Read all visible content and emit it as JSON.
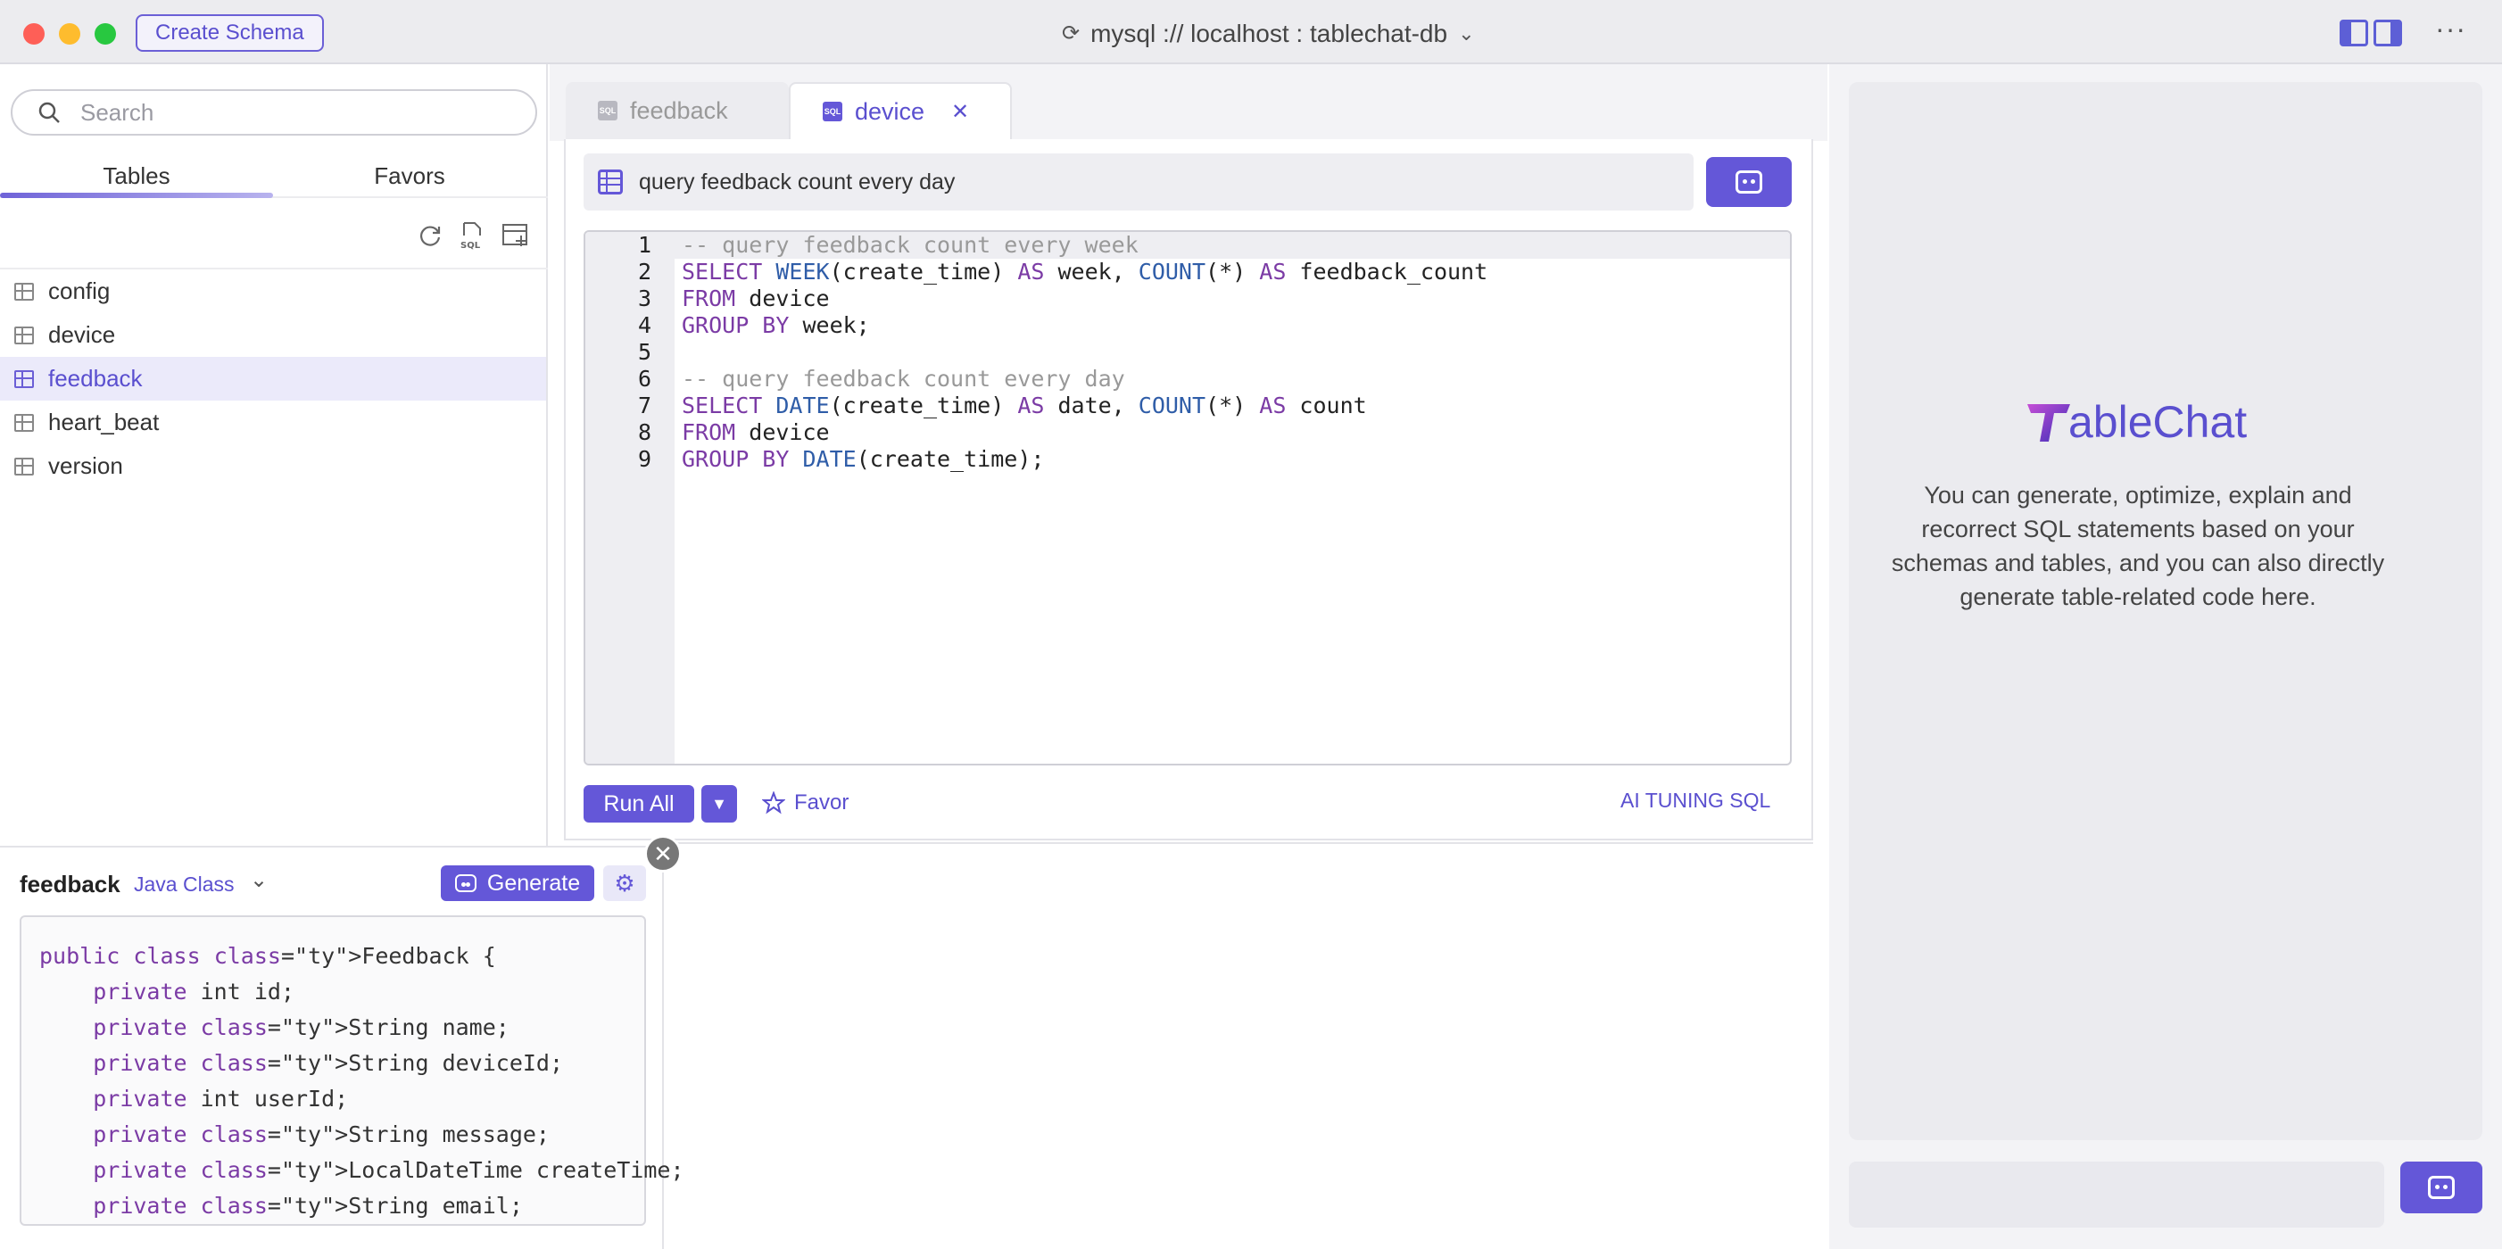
{
  "titlebar": {
    "create_schema_label": "Create Schema",
    "connection": "mysql :// localhost : tablechat-db"
  },
  "sidebar": {
    "search_placeholder": "Search",
    "tabs": [
      {
        "label": "Tables"
      },
      {
        "label": "Favors"
      }
    ],
    "tables": [
      {
        "label": "config"
      },
      {
        "label": "device"
      },
      {
        "label": "feedback"
      },
      {
        "label": "heart_beat"
      },
      {
        "label": "version"
      }
    ],
    "active_table": "feedback"
  },
  "codegen": {
    "table": "feedback",
    "type": "Java Class",
    "generate_label": "Generate",
    "code_lines": [
      "public class Feedback {",
      "    private int id;",
      "    private String name;",
      "    private String deviceId;",
      "    private int userId;",
      "    private String message;",
      "    private LocalDateTime createTime;",
      "    private String email;"
    ]
  },
  "editor": {
    "tabs": [
      {
        "label": "feedback",
        "icon": "sql-file-icon"
      },
      {
        "label": "device",
        "icon": "sql-file-icon"
      }
    ],
    "active_tab": "device",
    "prompt": "query feedback count every day",
    "line_numbers": [
      "1",
      "2",
      "3",
      "4",
      "5",
      "6",
      "7",
      "8",
      "9"
    ],
    "code": [
      "-- query feedback count every week",
      "SELECT WEEK(create_time) AS week, COUNT(*) AS feedback_count",
      "FROM device",
      "GROUP BY week;",
      "",
      "-- query feedback count every day",
      "SELECT DATE(create_time) AS date, COUNT(*) AS count",
      "FROM device",
      "GROUP BY DATE(create_time);"
    ],
    "run_all_label": "Run All",
    "favor_label": "Favor",
    "ai_tuning_label": "AI TUNING SQL"
  },
  "chat": {
    "logo_text": "ableChat",
    "description": "You can generate, optimize, explain and recorrect SQL statements based on your schemas and tables, and you can also directly generate table-related code here.",
    "input_placeholder": ""
  },
  "colors": {
    "accent": "#6457d8",
    "active_row": "#ebeafa"
  }
}
